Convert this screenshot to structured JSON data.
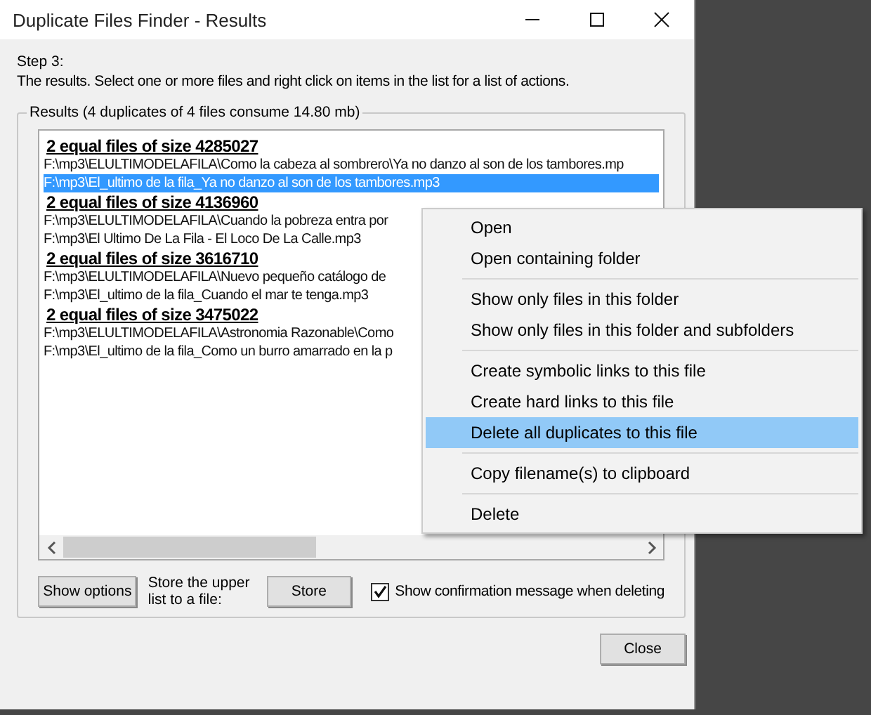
{
  "window": {
    "title": "Duplicate Files Finder - Results"
  },
  "step": "Step 3:",
  "instruction": "The results. Select one or more files and right click on items in the list for a list of actions.",
  "results": {
    "title": "Results (4 duplicates of 4 files consume 14.80 mb)",
    "rows": [
      {
        "kind": "header",
        "text": "2 equal files of size 4285027",
        "selected": false
      },
      {
        "kind": "file",
        "text": "F:\\mp3\\ELULTIMODELAFILA\\Como la cabeza al sombrero\\Ya no danzo al son de los tambores.mp",
        "selected": false
      },
      {
        "kind": "file",
        "text": "F:\\mp3\\El_ultimo de la fila_Ya no danzo al son de los tambores.mp3",
        "selected": true
      },
      {
        "kind": "header",
        "text": "2 equal files of size 4136960",
        "selected": false
      },
      {
        "kind": "file",
        "text": "F:\\mp3\\ELULTIMODELAFILA\\Cuando la pobreza entra por",
        "selected": false
      },
      {
        "kind": "file",
        "text": "F:\\mp3\\El Ultimo De La Fila - El Loco De La Calle.mp3",
        "selected": false
      },
      {
        "kind": "header",
        "text": "2 equal files of size 3616710",
        "selected": false
      },
      {
        "kind": "file",
        "text": "F:\\mp3\\ELULTIMODELAFILA\\Nuevo pequeño catálogo de",
        "selected": false
      },
      {
        "kind": "file",
        "text": "F:\\mp3\\El_ultimo de la fila_Cuando el mar te tenga.mp3",
        "selected": false
      },
      {
        "kind": "header",
        "text": "2 equal files of size 3475022",
        "selected": false
      },
      {
        "kind": "file",
        "text": "F:\\mp3\\ELULTIMODELAFILA\\Astronomia Razonable\\Como",
        "selected": false
      },
      {
        "kind": "file",
        "text": "F:\\mp3\\El_ultimo de la fila_Como un burro amarrado en la p",
        "selected": false
      }
    ]
  },
  "show_options_button": "Show options",
  "store_label": "Store the upper list to a file:",
  "store_button": "Store",
  "confirm_checkbox": {
    "label": "Show confirmation message when deleting",
    "checked": true
  },
  "close_button": "Close",
  "context_menu": {
    "groups": [
      [
        {
          "label": "Open",
          "selected": false
        },
        {
          "label": "Open containing folder",
          "selected": false
        }
      ],
      [
        {
          "label": "Show only files in this folder",
          "selected": false
        },
        {
          "label": "Show only files in this folder and subfolders",
          "selected": false
        }
      ],
      [
        {
          "label": "Create symbolic links to this file",
          "selected": false
        },
        {
          "label": "Create hard links to this file",
          "selected": false
        },
        {
          "label": "Delete all duplicates to this file",
          "selected": true
        }
      ],
      [
        {
          "label": "Copy filename(s) to clipboard",
          "selected": false
        }
      ],
      [
        {
          "label": "Delete",
          "selected": false
        }
      ]
    ]
  }
}
